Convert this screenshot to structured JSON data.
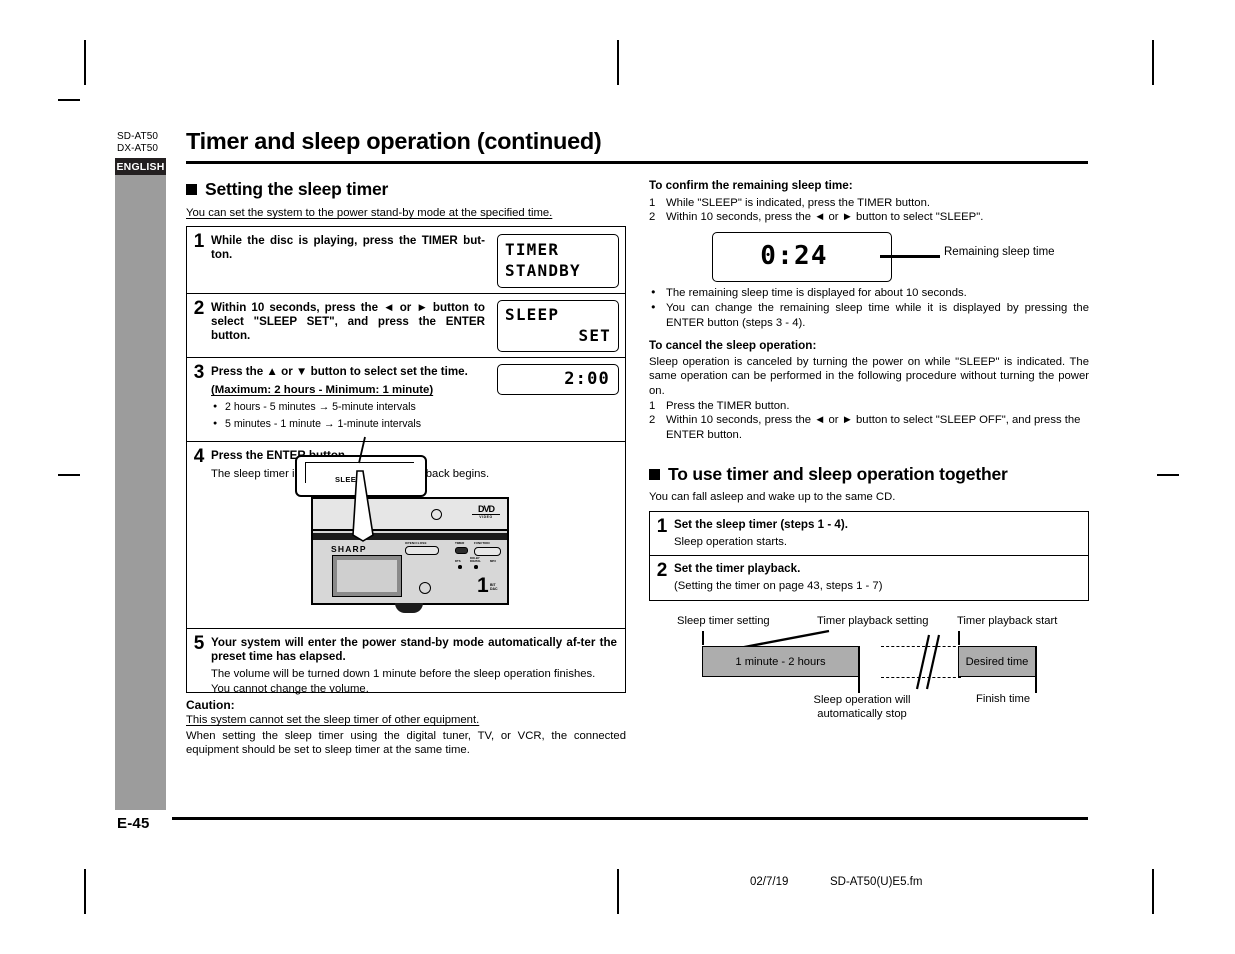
{
  "header": {
    "model_codes": [
      "SD-AT50",
      "DX-AT50"
    ],
    "language_tab": "ENGLISH",
    "page_title": "Timer and sleep operation (continued)",
    "page_number": "E-45"
  },
  "footer": {
    "date": "02/7/19",
    "filename": "SD-AT50(U)E5.fm"
  },
  "left_column": {
    "section_title": "Setting the sleep timer",
    "section_lead": "You can set the system to the power stand-by mode at the specified time.",
    "steps": [
      {
        "num": "1",
        "title": "While the disc is playing, press the TIMER but-ton.",
        "lcd_line1": "TIMER",
        "lcd_line2": "STANDBY"
      },
      {
        "num": "2",
        "title": "Within 10 seconds, press the ◄ or ► button to select \"SLEEP SET\", and press the ENTER button.",
        "lcd_line1": "SLEEP",
        "lcd_line2": "SET"
      },
      {
        "num": "3",
        "title": "Press the ▲ or ▼ button to select set the time.",
        "underlined_note": "(Maximum: 2 hours - Minimum: 1 minute)",
        "bullets": [
          "2 hours - 5 minutes → 5-minute intervals",
          "5 minutes - 1 minute → 1-minute intervals"
        ],
        "lcd_value": "2:00"
      },
      {
        "num": "4",
        "title": "Press the ENTER button.",
        "sub": "The sleep timer indicator lights up and playback begins.",
        "callout_label": "SLEEP",
        "device_brand": "SHARP",
        "device_logo": "DVD",
        "device_logo_sub": "VIDEO",
        "device_buttons": [
          "OPEN/CLOSE",
          "TIMER",
          "FUNCTION"
        ],
        "device_indicators": [
          "DTS",
          "DOLBY DIGITAL",
          "MP3"
        ]
      },
      {
        "num": "5",
        "title": "Your system will enter the power stand-by mode automatically af-ter the preset time has elapsed.",
        "sub1": "The volume will be turned down 1 minute before the sleep operation finishes.",
        "sub2": "You cannot change the volume."
      }
    ],
    "caution": {
      "heading": "Caution:",
      "underlined": "This system cannot set the sleep timer of other equipment.",
      "body": "When setting the sleep timer using the digital tuner, TV, or VCR, the connected equipment should be set to sleep timer at the same time."
    }
  },
  "right_column": {
    "confirm": {
      "heading": "To confirm the remaining sleep time:",
      "items": [
        {
          "n": "1",
          "text": "While \"SLEEP\" is indicated, press the TIMER button."
        },
        {
          "n": "2",
          "text": "Within 10 seconds, press the ◄ or ► button to select \"SLEEP\"."
        }
      ],
      "lcd_value": "0:24",
      "callout": "Remaining sleep time",
      "bullets": [
        "The remaining sleep time is displayed for about 10 seconds.",
        "You can change the remaining sleep time while it is displayed by pressing the ENTER button (steps 3 - 4)."
      ]
    },
    "cancel": {
      "heading": "To cancel the sleep operation:",
      "body": "Sleep operation is canceled by turning the power on while \"SLEEP\" is indicated. The same operation can be performed in the following procedure without turning the power on.",
      "items": [
        {
          "n": "1",
          "text": "Press the TIMER button."
        },
        {
          "n": "2",
          "text": "Within 10 seconds, press the ◄ or ► button to select \"SLEEP OFF\", and press the ENTER button."
        }
      ]
    },
    "together": {
      "section_title": "To use timer and sleep operation together",
      "section_lead": "You can fall asleep and wake up to the same CD.",
      "steps": [
        {
          "num": "1",
          "title": "Set the sleep timer (steps 1 - 4).",
          "sub": "Sleep operation starts."
        },
        {
          "num": "2",
          "title": "Set the timer playback.",
          "sub": "(Setting the timer on page 43, steps 1 - 7)"
        }
      ]
    },
    "timeline": {
      "label_left": "Sleep timer setting",
      "label_mid": "Timer playback setting",
      "label_right": "Timer playback start",
      "bar_left": "1 minute - 2 hours",
      "bar_right": "Desired time",
      "note_bottom_left": "Sleep operation will\nautomatically stop",
      "note_bottom_right": "Finish time"
    }
  }
}
